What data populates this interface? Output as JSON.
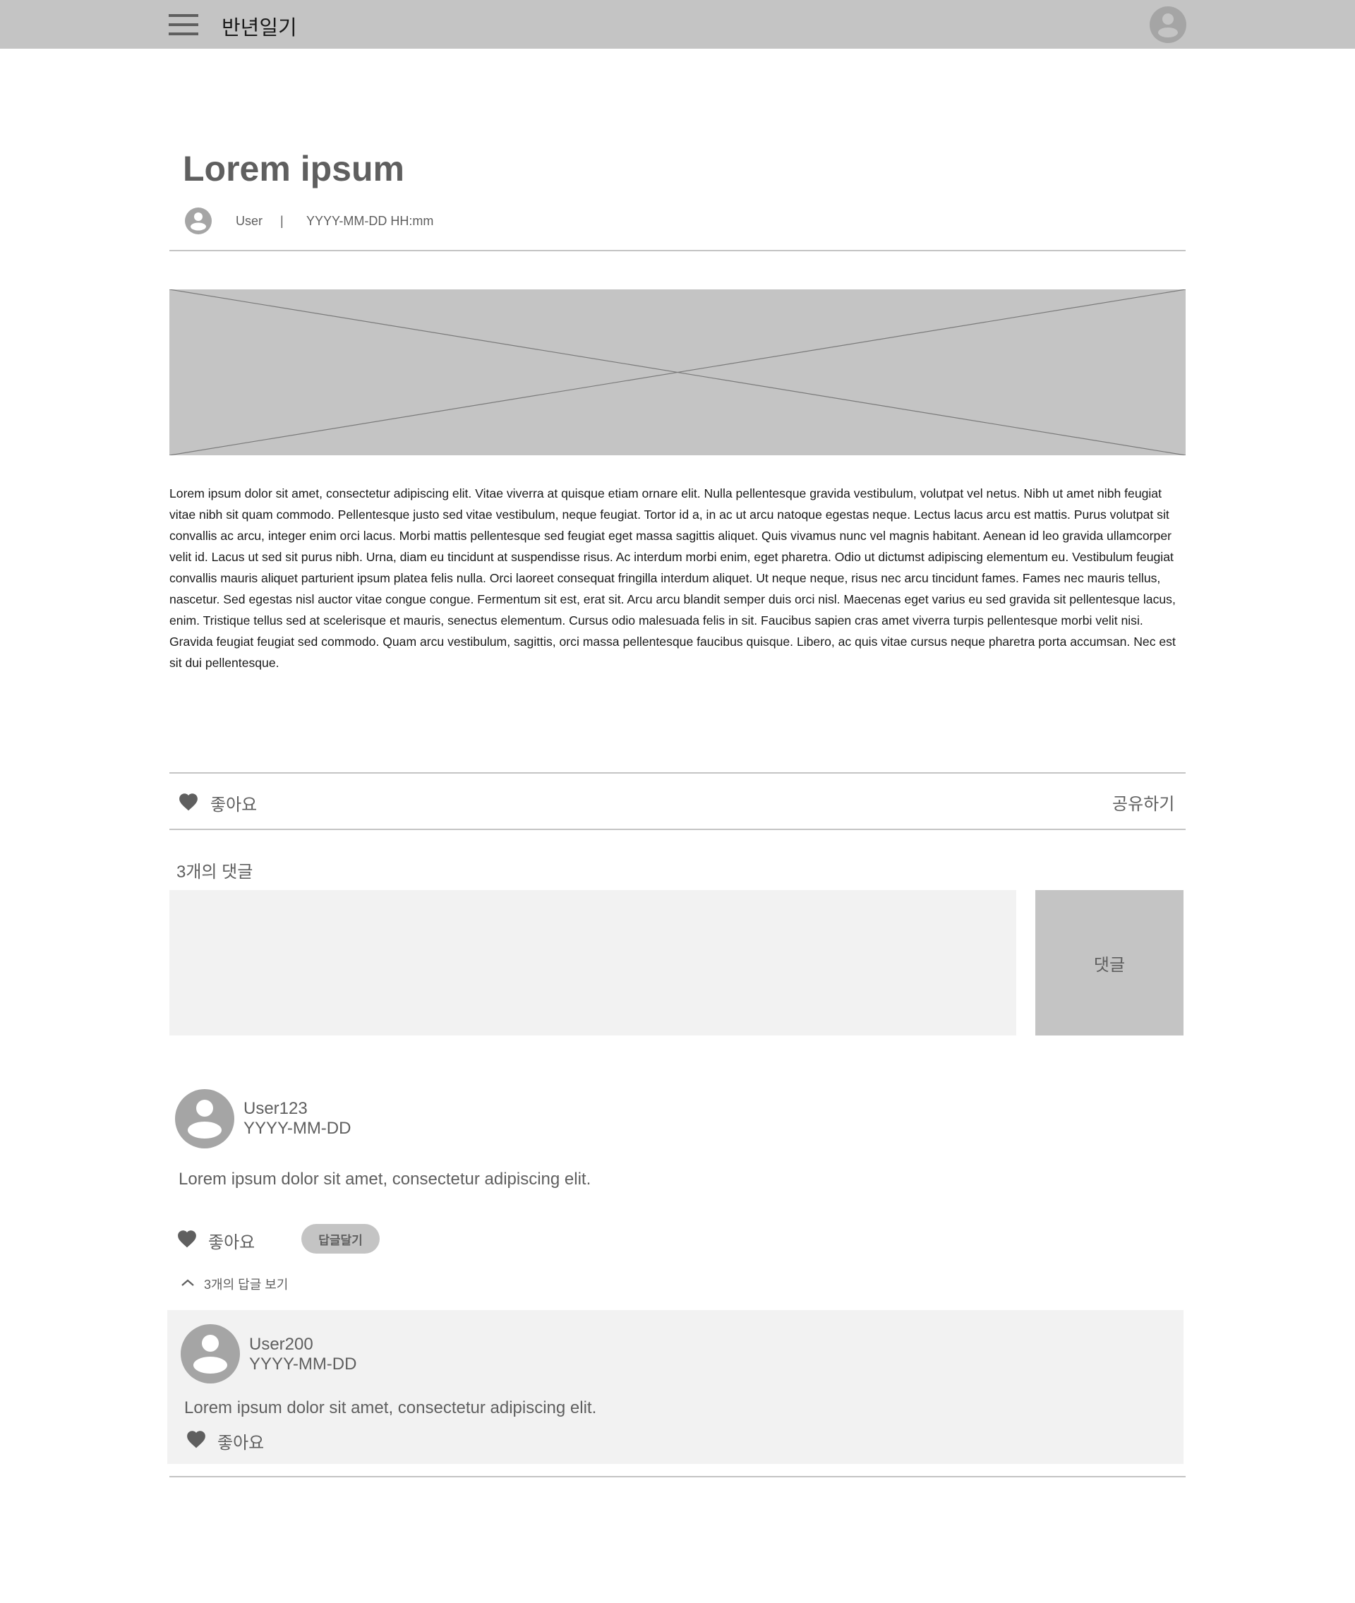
{
  "header": {
    "app_title": "반년일기",
    "menu_icon": "hamburger-menu-icon",
    "profile_icon": "user-avatar-icon",
    "background": "#c4c4c4"
  },
  "post": {
    "title": "Lorem ipsum",
    "author": "User",
    "separator": "|",
    "datetime": "YYYY-MM-DD HH:mm",
    "image": "image-placeholder",
    "body": "Lorem ipsum dolor sit amet, consectetur adipiscing elit. Vitae viverra at quisque etiam ornare elit. Nulla pellentesque gravida vestibulum, volutpat vel netus. Nibh ut amet nibh feugiat vitae nibh sit quam commodo. Pellentesque justo sed vitae vestibulum, neque feugiat. Tortor id a, in ac ut arcu natoque egestas neque. Lectus lacus arcu est mattis. Purus volutpat sit convallis ac arcu, integer enim orci lacus. Morbi mattis pellentesque sed feugiat eget massa sagittis aliquet. Quis vivamus nunc vel magnis habitant. Aenean id leo gravida ullamcorper velit id. Lacus ut sed sit purus nibh. Urna, diam eu tincidunt at suspendisse risus. Ac interdum morbi enim, eget pharetra. Odio ut dictumst adipiscing elementum eu. Vestibulum feugiat convallis mauris aliquet parturient ipsum platea felis nulla. Orci laoreet consequat fringilla interdum aliquet. Ut neque neque, risus nec arcu tincidunt fames. Fames nec mauris tellus, nascetur. Sed egestas nisl auctor vitae congue congue. Fermentum sit est, erat sit. Arcu arcu blandit semper duis orci nisl. Maecenas eget varius eu sed gravida sit pellentesque lacus, enim. Tristique tellus sed at scelerisque et mauris, senectus elementum. Cursus odio malesuada felis in sit. Faucibus sapien cras amet viverra turpis pellentesque morbi velit nisi. Gravida feugiat feugiat sed commodo. Quam arcu vestibulum, sagittis, orci massa pellentesque faucibus quisque. Libero, ac quis vitae cursus neque pharetra porta accumsan. Nec est sit dui pellentesque."
  },
  "actions": {
    "like_label": "좋아요",
    "share_label": "공유하기",
    "like_icon": "heart-icon"
  },
  "comments": {
    "count_label": "3개의 댓글",
    "input_placeholder": "",
    "submit_label": "댓글",
    "items": [
      {
        "user": "User123",
        "date": "YYYY-MM-DD",
        "text": "Lorem ipsum dolor sit amet, consectetur adipiscing elit.",
        "like_label": "좋아요",
        "reply_button_label": "답글달기",
        "replies_toggle_label": "3개의 답글 보기",
        "replies": [
          {
            "user": "User200",
            "date": "YYYY-MM-DD",
            "text": "Lorem ipsum dolor sit amet, consectetur adipiscing elit.",
            "like_label": "좋아요"
          }
        ]
      }
    ]
  },
  "colors": {
    "placeholder_gray": "#c4c4c4",
    "light_gray": "#f2f2f2",
    "text_gray": "#5f5f5f",
    "avatar_gray": "#a5a5a5"
  }
}
